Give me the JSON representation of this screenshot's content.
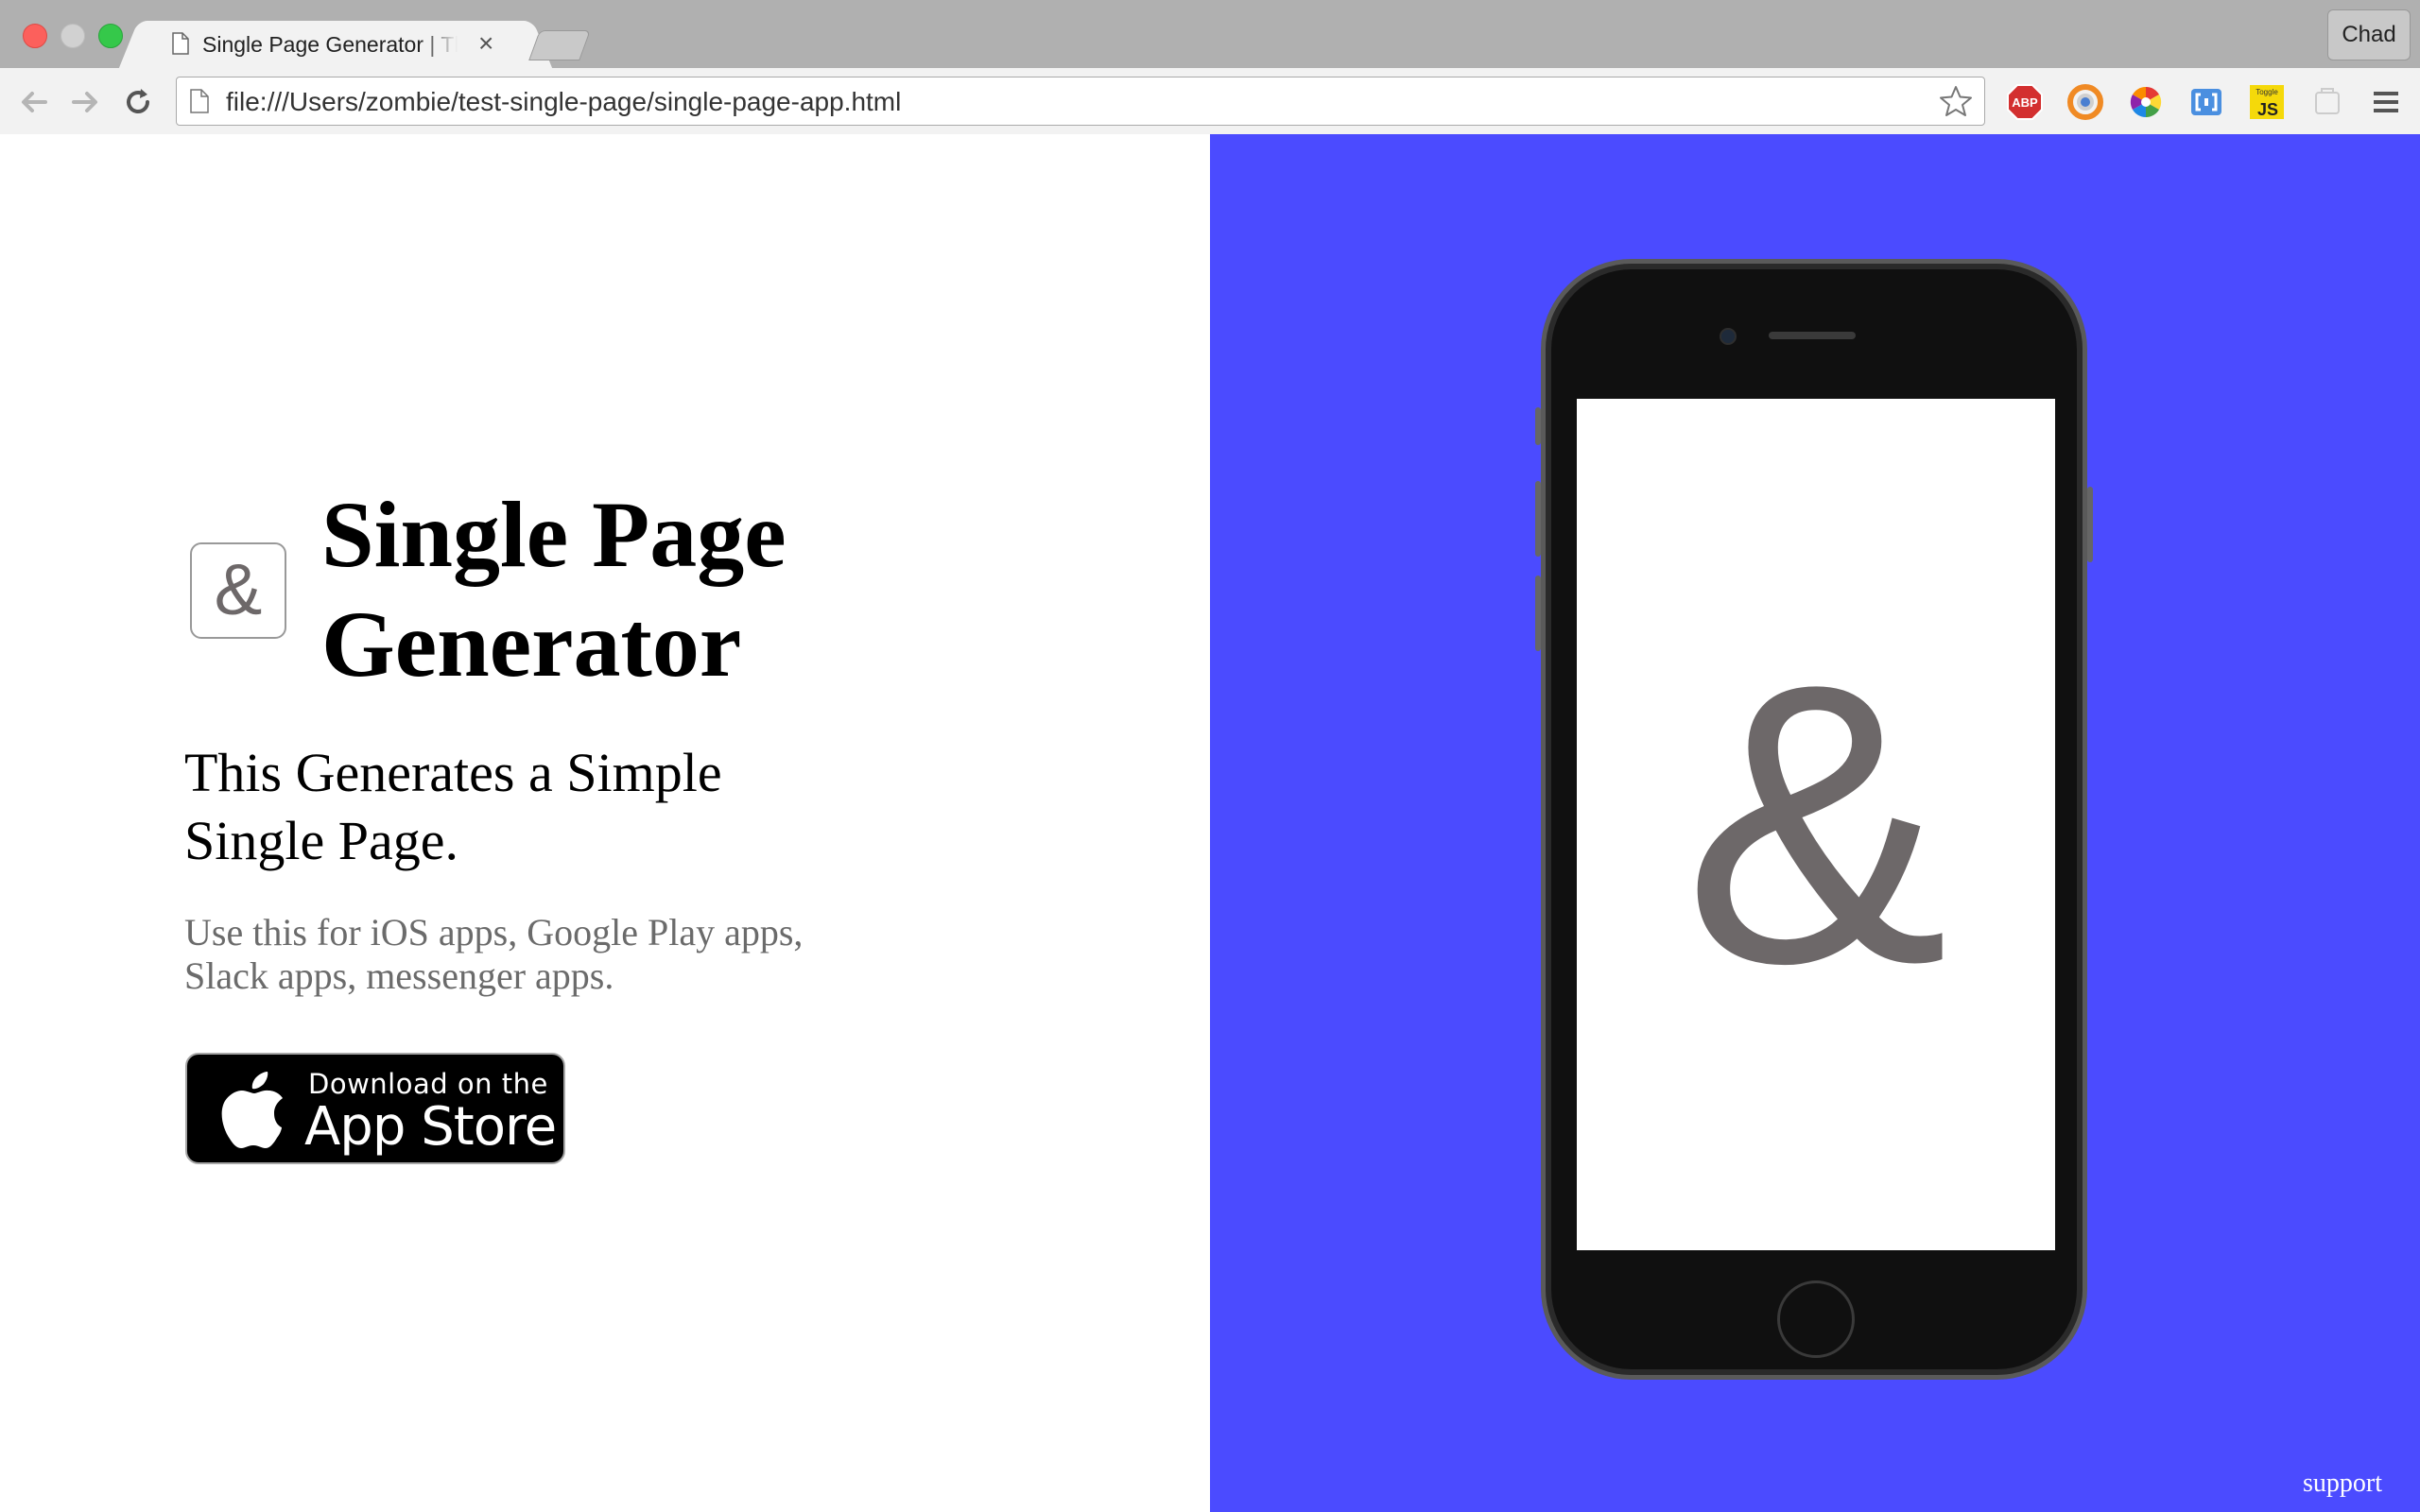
{
  "browser": {
    "tab": {
      "title": "Single Page Generator | This Generates a Simple Single Page.",
      "close": "×"
    },
    "profile_name": "Chad",
    "url": "file:///Users/zombie/test-single-page/single-page-app.html",
    "extensions": {
      "abp": "ABP",
      "js": "JS",
      "js_tag": "Toggle"
    }
  },
  "hero": {
    "icon_glyph": "&",
    "title": "Single Page Generator",
    "subtitle": "This Generates a Simple Single Page.",
    "description": "Use this for iOS apps, Google Play apps, Slack apps, messenger apps.",
    "appstore": {
      "line1": "Download on the",
      "line2": "App Store"
    }
  },
  "phone_screen": {
    "glyph": "&"
  },
  "footer": {
    "support": "support"
  },
  "colors": {
    "accent": "#4b4bff",
    "logo_grey": "#6d6869"
  }
}
